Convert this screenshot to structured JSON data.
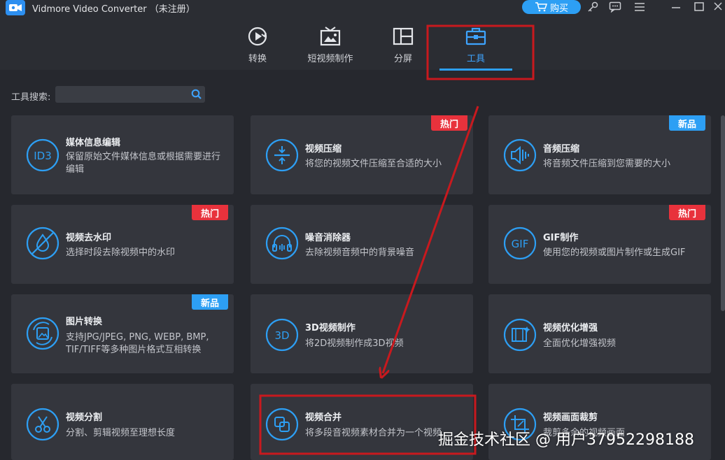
{
  "titlebar": {
    "app_name": "Vidmore Video Converter  （未注册）",
    "buy_label": "购买"
  },
  "nav": {
    "tabs": [
      {
        "label": "转换",
        "icon": "convert-icon"
      },
      {
        "label": "短视频制作",
        "icon": "mv-icon"
      },
      {
        "label": "分屏",
        "icon": "collage-icon"
      },
      {
        "label": "工具",
        "icon": "toolbox-icon",
        "active": true
      }
    ]
  },
  "search": {
    "label": "工具搜索:",
    "value": ""
  },
  "tools": [
    {
      "title": "媒体信息编辑",
      "desc": "保留原始文件媒体信息或根据需要进行编辑",
      "icon": "id3-icon",
      "badge": ""
    },
    {
      "title": "视频压缩",
      "desc": "将您的视频文件压缩至合适的大小",
      "icon": "compress-icon",
      "badge": "热门"
    },
    {
      "title": "音频压缩",
      "desc": "将音频文件压缩到您需要的大小",
      "icon": "audio-compress-icon",
      "badge": "新品"
    },
    {
      "title": "视频去水印",
      "desc": "选择时段去除视频中的水印",
      "icon": "watermark-remove-icon",
      "badge": "热门"
    },
    {
      "title": "噪音消除器",
      "desc": "去除视频音频中的背景噪音",
      "icon": "headphone-icon",
      "badge": ""
    },
    {
      "title": "GIF制作",
      "desc": "使用您的视频或图片制作或生成GIF",
      "icon": "gif-icon",
      "badge": "热门"
    },
    {
      "title": "图片转换",
      "desc": "支持JPG/JPEG, PNG, WEBP, BMP, TIF/TIFF等多种图片格式互相转换",
      "icon": "image-convert-icon",
      "badge": "新品"
    },
    {
      "title": "3D视频制作",
      "desc": "将2D视频制作成3D视频",
      "icon": "3d-icon",
      "badge": ""
    },
    {
      "title": "视频优化增强",
      "desc": "全面优化增强视频",
      "icon": "enhance-icon",
      "badge": ""
    },
    {
      "title": "视频分割",
      "desc": "分割、剪辑视频至理想长度",
      "icon": "scissors-icon",
      "badge": ""
    },
    {
      "title": "视频合并",
      "desc": "将多段音视频素材合并为一个视频",
      "icon": "merge-icon",
      "badge": ""
    },
    {
      "title": "视频画面裁剪",
      "desc": "裁剪多余的视频画面",
      "icon": "crop-icon",
      "badge": ""
    }
  ],
  "icon_text": {
    "id3": "ID3",
    "gif": "GIF",
    "three_d": "3D"
  },
  "watermark": "掘金技术社区 @ 用户37952298188",
  "colors": {
    "accent": "#2d9ff4",
    "hot_badge": "#e8323c",
    "annotation": "#c8191e",
    "card_bg": "#34363d",
    "page_bg": "#26282e"
  }
}
